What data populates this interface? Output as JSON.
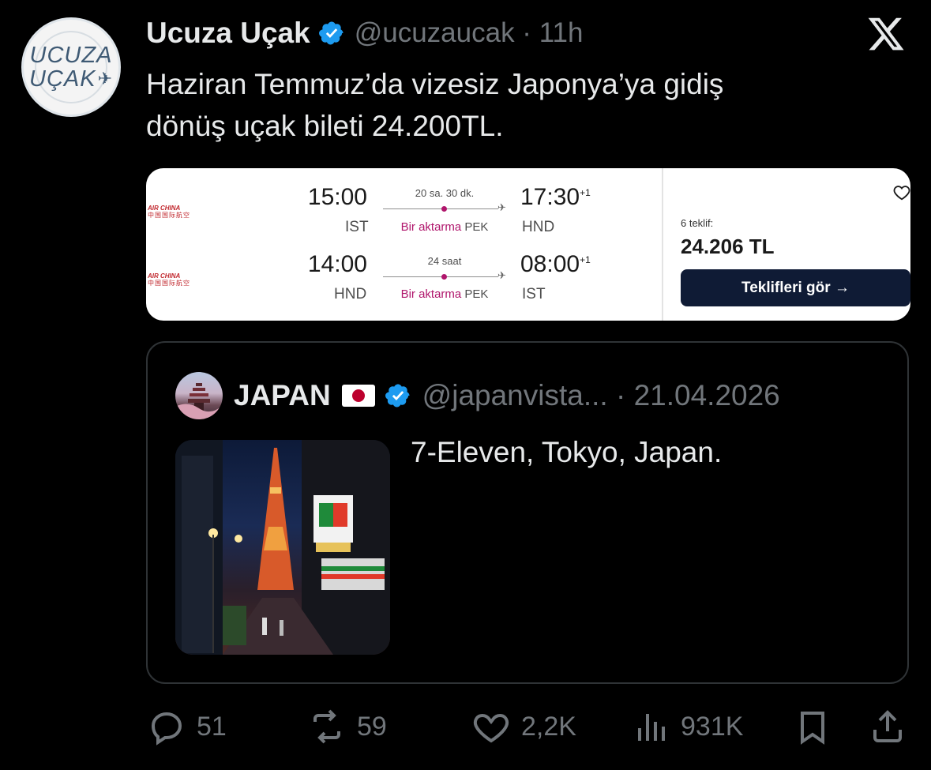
{
  "author": {
    "name": "Ucuza Uçak",
    "handle": "@ucuzaucak",
    "time": "11h",
    "avatar_lines": [
      "UCUZA",
      "UÇAK"
    ]
  },
  "tweet": {
    "text": "Haziran Temmuz’da vizesiz Japonya’ya gidiş\ndönüş uçak bileti 24.200TL."
  },
  "flight_card": {
    "outbound": {
      "airline": "AIR CHINA",
      "depart_time": "15:00",
      "depart_code": "IST",
      "duration": "20 sa. 30 dk.",
      "stops": "Bir aktarma",
      "stop_code": "PEK",
      "arrive_time": "17:30",
      "arrive_plus": "+1",
      "arrive_code": "HND"
    },
    "return": {
      "airline": "AIR CHINA",
      "depart_time": "14:00",
      "depart_code": "HND",
      "duration": "24 saat",
      "stops": "Bir aktarma",
      "stop_code": "PEK",
      "arrive_time": "08:00",
      "arrive_plus": "+1",
      "arrive_code": "IST"
    },
    "offers_label": "6 teklif:",
    "price": "24.206 TL",
    "cta_label": "Teklifleri gör →"
  },
  "quote": {
    "name": "JAPAN",
    "handle": "@japanvista...",
    "date": "21.04.2026",
    "text": "7-Eleven, Tokyo, Japan."
  },
  "actions": {
    "replies": "51",
    "reposts": "59",
    "likes": "2,2K",
    "views": "931K"
  },
  "colors": {
    "background": "#000000",
    "verified": "#1d9bf0",
    "muted": "#71767b",
    "stop_accent": "#b0166c",
    "cta_bg": "#0f1b35"
  }
}
